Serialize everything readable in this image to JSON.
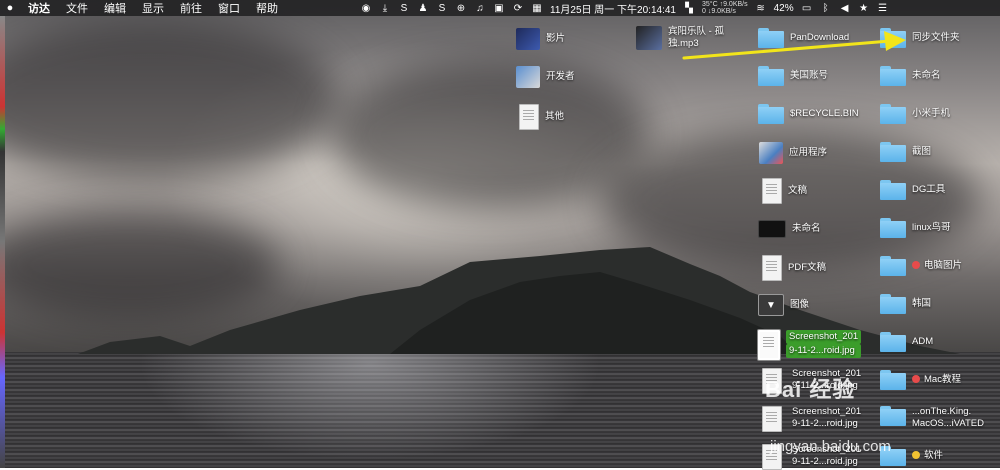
{
  "menubar": {
    "app_name": "访达",
    "menus": [
      "文件",
      "编辑",
      "显示",
      "前往",
      "窗口",
      "帮助"
    ],
    "net_up": "35°C ↑9.0KB/s",
    "net_down": "0 ↓9.0KB/s",
    "datetime": "11月25日 周一 下午20:14:41",
    "battery": "42%"
  },
  "desktop_icons": {
    "col1": [
      {
        "label": "影片",
        "icon": "movies-icon"
      },
      {
        "label": "开发者",
        "icon": "developer-icon"
      },
      {
        "label": "其他",
        "icon": "other-icon"
      }
    ],
    "mp3": {
      "line1": "宾阳乐队 - 孤",
      "line2": "独.mp3"
    },
    "col3": [
      {
        "label": "PanDownload",
        "type": "folder"
      },
      {
        "label": "美国账号",
        "type": "folder"
      },
      {
        "label": "$RECYCLE.BIN",
        "type": "folder"
      },
      {
        "label": "应用程序",
        "type": "app"
      },
      {
        "label": "文稿",
        "type": "doc"
      },
      {
        "label": "未命名",
        "type": "dark"
      },
      {
        "label": "PDF文稿",
        "type": "doc"
      },
      {
        "label": "图像",
        "type": "image"
      },
      {
        "label1": "Screenshot_201",
        "label2": "9-11-2...roid.jpg",
        "selected": true
      },
      {
        "label1": "Screenshot_201",
        "label2": "9-11-2...roid.jpg"
      },
      {
        "label1": "Screenshot_201",
        "label2": "9-11-2...roid.jpg"
      },
      {
        "label1": "Screenshot_201",
        "label2": "9-11-2...roid.jpg"
      }
    ],
    "col4": [
      {
        "label": "同步文件夹"
      },
      {
        "label": "未命名"
      },
      {
        "label": "小米手机"
      },
      {
        "label": "截图"
      },
      {
        "label": "DG工具"
      },
      {
        "label": "linux鸟哥"
      },
      {
        "label": "电脑图片",
        "tag": "red"
      },
      {
        "label": "韩国"
      },
      {
        "label": "ADM"
      },
      {
        "label": "Mac教程",
        "tag": "red"
      },
      {
        "label": "...onThe.King.",
        "label2": "MacOS...iVATED"
      },
      {
        "label": "软件",
        "tag": "yellow"
      }
    ]
  },
  "watermark": {
    "line1": "Bai 经验",
    "line2": "jingyan.baidu.com"
  }
}
